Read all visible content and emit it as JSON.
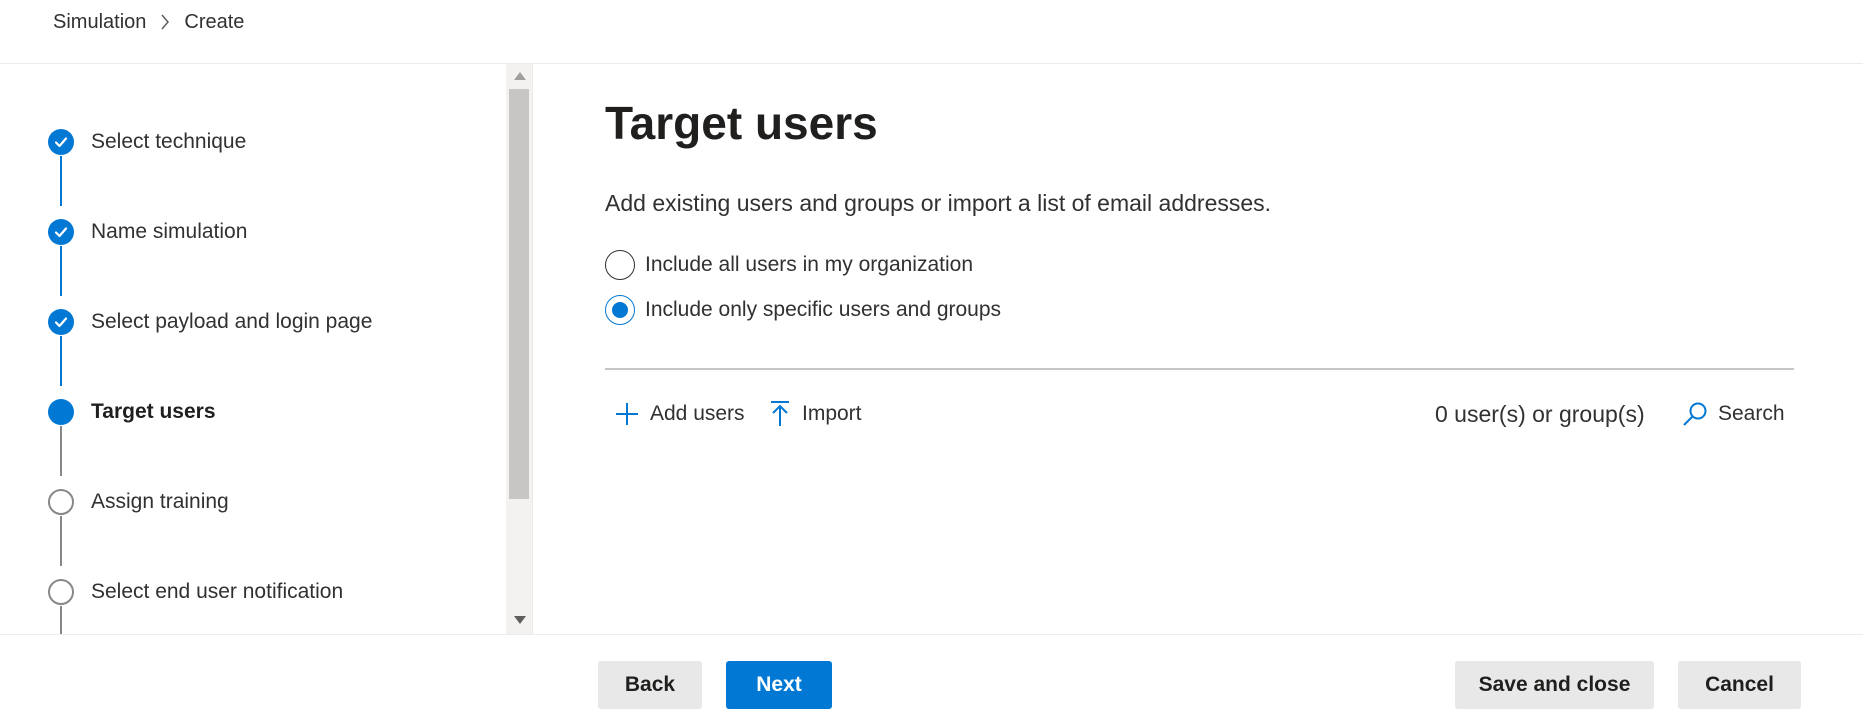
{
  "breadcrumb": {
    "items": [
      "Simulation",
      "Create"
    ]
  },
  "steps": [
    {
      "label": "Select technique",
      "state": "done"
    },
    {
      "label": "Name simulation",
      "state": "done"
    },
    {
      "label": "Select payload and login page",
      "state": "done"
    },
    {
      "label": "Target users",
      "state": "current"
    },
    {
      "label": "Assign training",
      "state": "todo"
    },
    {
      "label": "Select end user notification",
      "state": "todo"
    }
  ],
  "main": {
    "title": "Target users",
    "description": "Add existing users and groups or import a list of email addresses.",
    "options": [
      {
        "label": "Include all users in my organization",
        "selected": false
      },
      {
        "label": "Include only specific users and groups",
        "selected": true
      }
    ],
    "commands": {
      "add_users": "Add users",
      "import": "Import",
      "search": "Search"
    },
    "count": "0 user(s) or group(s)"
  },
  "footer": {
    "back": "Back",
    "next": "Next",
    "save_close": "Save and close",
    "cancel": "Cancel"
  },
  "colors": {
    "accent": "#0078d4",
    "text": "#323130",
    "inactive": "#8a8886"
  }
}
